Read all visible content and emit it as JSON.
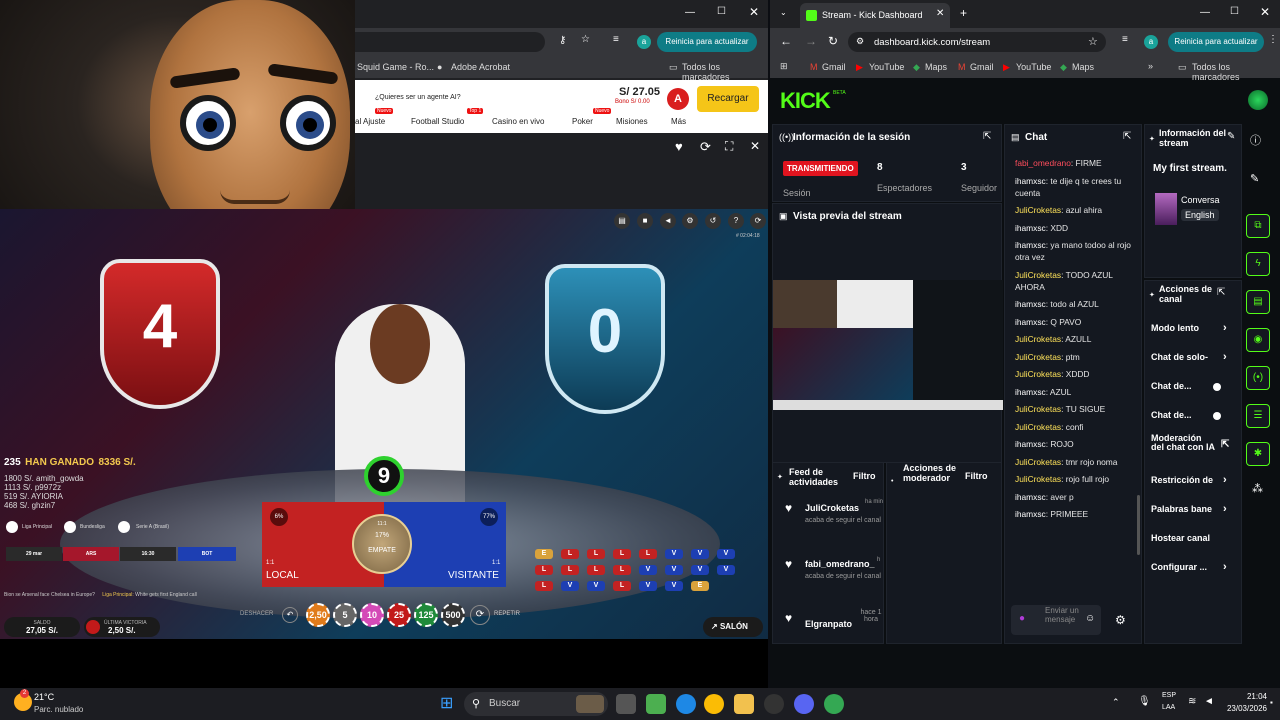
{
  "left_browser": {
    "update_btn": "Reinicia para actualizar",
    "bookmarks": [
      "Squid Game - Ro...",
      "Adobe Acrobat"
    ],
    "all_bookmarks": "Todos los marcadores",
    "promo": "¿Quieres ser un agente AI?",
    "balance": "S/ 27.05",
    "bonus": "Bono S/ 0.00",
    "avatar_letter": "A",
    "recharge": "Recargar",
    "nav": [
      {
        "label": "al Ajuste",
        "badge": "Nuevo"
      },
      {
        "label": "Football Studio",
        "badge": "Top 1"
      },
      {
        "label": "Casino en vivo",
        "badge": ""
      },
      {
        "label": "Poker",
        "badge": "Nuevo"
      },
      {
        "label": "Misiones",
        "badge": ""
      },
      {
        "label": "Más",
        "badge": ""
      }
    ]
  },
  "game": {
    "home_score": "4",
    "away_score": "0",
    "winners_header": "235",
    "winners_text": "HAN GANADO",
    "winners_amount": "8336 S/.",
    "winners": [
      "1800 S/. amith_gowda",
      "1113 S/. p9972z",
      "519 S/. AYIORIA",
      "468 S/. ghzin7"
    ],
    "leagues": [
      "Liga Principal",
      "Bundesliga",
      "Serie A (Brasil)"
    ],
    "match_row": [
      "29 mar",
      "ARS",
      "16:30",
      "BOT"
    ],
    "ticker_q": "Bion se Arsenal face Chelsea in Europe?",
    "ticker_league": "Liga Principal:",
    "ticker_text": "White gets first England call",
    "timer": "9",
    "local_pct": "6%",
    "visit_pct": "77%",
    "empate_pct": "17%",
    "empate_odds": "11:1",
    "local_odds": "1:1",
    "visit_odds": "1:1",
    "local_label": "LOCAL",
    "empate_label": "EMPATE",
    "visit_label": "VISITANTE",
    "chips": [
      "2,50",
      "5",
      "10",
      "25",
      "125",
      "500"
    ],
    "undo": "DESHACER",
    "repeat": "REPETIR",
    "saldo_label": "SALDO",
    "saldo_value": "27,05 S/.",
    "last_win_label": "ÚLTIMA VICTORIA",
    "last_win_value": "2,50 S/.",
    "lobby": "SALÓN",
    "round_id": "# 02:04:18",
    "road": [
      "E",
      "L",
      "L",
      "L",
      "L",
      "V",
      "V",
      "V",
      "L",
      "L",
      "L",
      "L",
      "V",
      "V",
      "V",
      "V",
      "L",
      "V",
      "V",
      "L",
      "V",
      "V",
      "E"
    ]
  },
  "right_browser": {
    "tab_title": "Stream - Kick Dashboard",
    "url": "dashboard.kick.com/stream",
    "update_btn": "Reinicia para actualizar",
    "bookmarks": [
      "Gmail",
      "YouTube",
      "Maps",
      "Gmail",
      "YouTube",
      "Maps"
    ],
    "all_bookmarks": "Todos los marcadores",
    "logo": "KICK",
    "logo_sup": "BETA",
    "session": {
      "title": "Información de la sesión",
      "status": "TRANSMITIENDO",
      "status_label": "Sesión",
      "viewers": "8",
      "viewers_label": "Espectadores",
      "followers": "3",
      "followers_label": "Seguidor"
    },
    "preview_title": "Vista previa del stream",
    "activity": {
      "title": "Feed de actividades",
      "filter": "Filtro",
      "items": [
        {
          "user": "JuliCroketas",
          "time": "ha min",
          "text": "acaba de seguir el canal"
        },
        {
          "user": "fabi_omedrano_",
          "time": "h",
          "text": "acaba de seguir el canal"
        },
        {
          "user": "Elgranpato",
          "time": "hace 1 hora",
          "text": ""
        }
      ]
    },
    "mod_actions": {
      "title": "Acciones de moderador",
      "filter": "Filtro"
    },
    "chat": {
      "title": "Chat",
      "placeholder": "Enviar un mensaje",
      "messages": [
        {
          "user": "fabi_omedrano",
          "text": "FIRME",
          "color": "r"
        },
        {
          "user": "ihamxsc",
          "text": "te dije q te crees tu cuenta",
          "color": "w"
        },
        {
          "user": "JuliCroketas",
          "text": "azul ahira",
          "color": "g"
        },
        {
          "user": "ihamxsc",
          "text": "XDD",
          "color": "w"
        },
        {
          "user": "ihamxsc",
          "text": "ya mano todoo al rojo otra vez",
          "color": "w"
        },
        {
          "user": "JuliCroketas",
          "text": "TODO AZUL AHORA",
          "color": "g"
        },
        {
          "user": "ihamxsc",
          "text": "todo al AZUL",
          "color": "w"
        },
        {
          "user": "ihamxsc",
          "text": "Q PAVO",
          "color": "w"
        },
        {
          "user": "JuliCroketas",
          "text": "AZULL",
          "color": "g"
        },
        {
          "user": "JuliCroketas",
          "text": "ptm",
          "color": "g"
        },
        {
          "user": "JuliCroketas",
          "text": "XDDD",
          "color": "g"
        },
        {
          "user": "ihamxsc",
          "text": "AZUL",
          "color": "w"
        },
        {
          "user": "JuliCroketas",
          "text": "TU SIGUE",
          "color": "g"
        },
        {
          "user": "JuliCroketas",
          "text": "confi",
          "color": "g"
        },
        {
          "user": "ihamxsc",
          "text": "ROJO",
          "color": "w"
        },
        {
          "user": "JuliCroketas",
          "text": "tmr rojo noma",
          "color": "g"
        },
        {
          "user": "JuliCroketas",
          "text": "rojo full rojo",
          "color": "g"
        },
        {
          "user": "ihamxsc",
          "text": "aver p",
          "color": "w"
        },
        {
          "user": "ihamxsc",
          "text": "PRIMEEE",
          "color": "w"
        }
      ]
    },
    "stream_info": {
      "title": "Información del stream",
      "stream_title": "My first stream.",
      "category": "Conversa",
      "language": "English"
    },
    "channel_actions": {
      "title": "Acciones de canal",
      "items": [
        {
          "label": "Modo lento",
          "control": "chevron"
        },
        {
          "label": "Chat de solo-",
          "control": "chevron"
        },
        {
          "label": "Chat de...",
          "control": "toggle"
        },
        {
          "label": "Chat de...",
          "control": "toggle"
        },
        {
          "label": "Moderación del chat con IA",
          "control": "link"
        },
        {
          "label": "Restricción de",
          "control": "chevron"
        },
        {
          "label": "Palabras bane",
          "control": "chevron"
        },
        {
          "label": "Hostear canal",
          "control": "none"
        },
        {
          "label": "Configurar ...",
          "control": "chevron"
        }
      ]
    }
  },
  "taskbar": {
    "weather_temp": "21°C",
    "weather_desc": "Parc. nublado",
    "search": "Buscar",
    "lang": "ESP",
    "lang2": "LAA",
    "time": "21:04",
    "date": "23/03/2026"
  },
  "colors": {
    "kick_green": "#53fc18",
    "live_red": "#e1141f",
    "local_red": "#c32222",
    "visit_blue": "#1d3fb3"
  }
}
